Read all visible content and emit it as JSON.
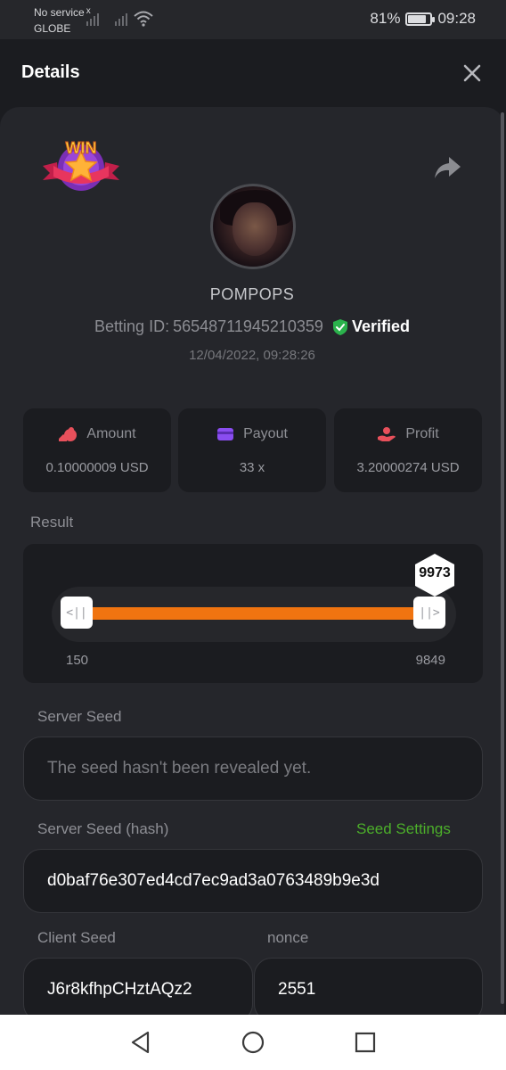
{
  "status_bar": {
    "carrier_line1": "No service",
    "carrier_x": "x",
    "carrier_line2": "GLOBE",
    "battery_percent": "81%",
    "battery_level": 0.81,
    "time": "09:28"
  },
  "header": {
    "title": "Details",
    "close_icon": "close-icon"
  },
  "bet": {
    "badge_text": "WIN",
    "username": "POMPOPS",
    "betting_id_label": "Betting ID:",
    "betting_id": "56548711945210359",
    "verified_label": "Verified",
    "timestamp": "12/04/2022, 09:28:26"
  },
  "stats": [
    {
      "label": "Amount",
      "value": "0.10000009 USD",
      "icon": "coins-icon",
      "color": "#e8505b"
    },
    {
      "label": "Payout",
      "value": "33 x",
      "icon": "card-icon",
      "color": "#8a4df0"
    },
    {
      "label": "Profit",
      "value": "3.20000274 USD",
      "icon": "hand-coin-icon",
      "color": "#e8505b"
    }
  ],
  "result": {
    "label": "Result",
    "roll": "9973",
    "range_low": "150",
    "range_high": "9849",
    "handle_left": "<||",
    "handle_right": "||>",
    "accent": "#f07410"
  },
  "server_seed": {
    "label": "Server Seed",
    "placeholder": "The seed hasn't been revealed yet."
  },
  "server_seed_hash": {
    "label": "Server Seed (hash)",
    "link": "Seed Settings",
    "value": "d0baf76e307ed4cd7ec9ad3a0763489b9e3d"
  },
  "client_seed": {
    "label": "Client Seed",
    "value": "J6r8kfhpCHztAQz2"
  },
  "nonce": {
    "label": "nonce",
    "value": "2551"
  },
  "colors": {
    "verified_green": "#2bb24c",
    "link_green": "#4caf2a",
    "card_bg": "#25262b",
    "box_bg": "#1b1c20"
  }
}
